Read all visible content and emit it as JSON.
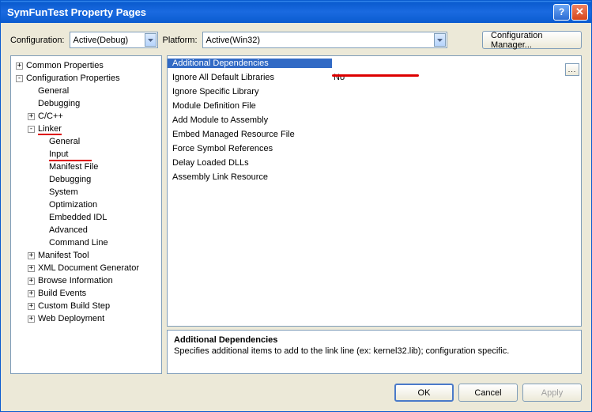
{
  "title": "SymFunTest Property Pages",
  "toprow": {
    "config_lbl": "Configuration:",
    "config_val": "Active(Debug)",
    "platform_lbl": "Platform:",
    "platform_val": "Active(Win32)",
    "cfgmgr": "Configuration Manager..."
  },
  "tree": {
    "n0": "Common Properties",
    "n1": "Configuration Properties",
    "n1_0": "General",
    "n1_1": "Debugging",
    "n1_2": "C/C++",
    "n1_3": "Linker",
    "n1_3_0": "General",
    "n1_3_1": "Input",
    "n1_3_2": "Manifest File",
    "n1_3_3": "Debugging",
    "n1_3_4": "System",
    "n1_3_5": "Optimization",
    "n1_3_6": "Embedded IDL",
    "n1_3_7": "Advanced",
    "n1_3_8": "Command Line",
    "n1_4": "Manifest Tool",
    "n1_5": "XML Document Generator",
    "n1_6": "Browse Information",
    "n1_7": "Build Events",
    "n1_8": "Custom Build Step",
    "n1_9": "Web Deployment"
  },
  "grid": {
    "r0n": "Additional Dependencies",
    "r0v": "",
    "r1n": "Ignore All Default Libraries",
    "r1v": "No",
    "r2n": "Ignore Specific Library",
    "r2v": "",
    "r3n": "Module Definition File",
    "r3v": "",
    "r4n": "Add Module to Assembly",
    "r4v": "",
    "r5n": "Embed Managed Resource File",
    "r5v": "",
    "r6n": "Force Symbol References",
    "r6v": "",
    "r7n": "Delay Loaded DLLs",
    "r7v": "",
    "r8n": "Assembly Link Resource",
    "r8v": ""
  },
  "desc": {
    "title": "Additional Dependencies",
    "body": "Specifies additional items to add to the link line (ex: kernel32.lib); configuration specific."
  },
  "footer": {
    "ok": "OK",
    "cancel": "Cancel",
    "apply": "Apply"
  }
}
